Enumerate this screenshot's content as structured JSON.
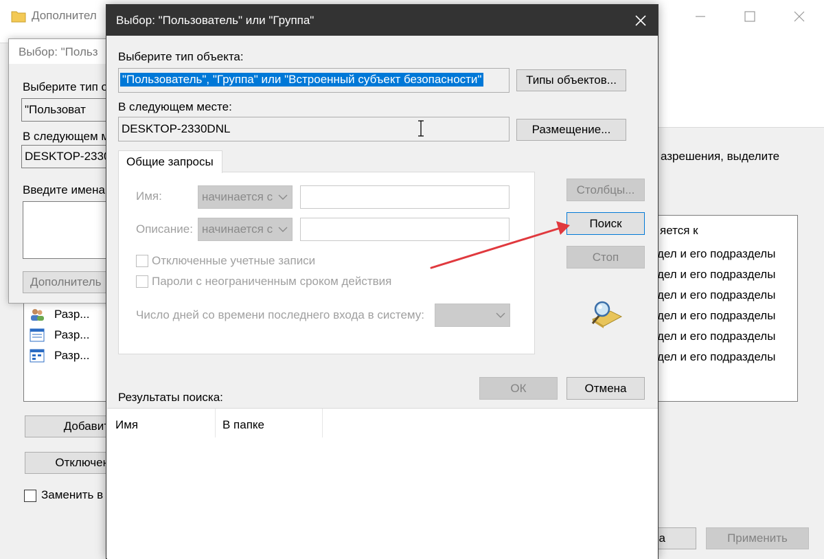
{
  "bg_window": {
    "title": "Дополнител",
    "permissions_text": "азрешения, выделите",
    "column_header": "яется к",
    "inherit_rows": [
      "дел и его подразделы",
      "дел и его подразделы",
      "дел и его подразделы",
      "дел и его подразделы",
      "дел и его подразделы",
      "дел и его подразделы"
    ],
    "perm_items": [
      "Разр...",
      "Разр...",
      "Разр..."
    ],
    "add_button": "Добавит",
    "disable_button": "Отключен",
    "replace_checkbox_label": "Заменить в",
    "ok_button_partial": "на",
    "apply_button": "Применить"
  },
  "mid_dialog": {
    "title": "Выбор: \"Польз",
    "object_type_label": "Выберите тип о",
    "object_type_value": "\"Пользоват",
    "location_label": "В следующем м",
    "location_value": "DESKTOP-2330",
    "enter_names_label": "Введите имена",
    "advanced_button": "Дополнитель"
  },
  "dialog": {
    "title": "Выбор: \"Пользователь\" или \"Группа\"",
    "object_type_label": "Выберите тип объекта:",
    "object_type_value": "\"Пользователь\", \"Группа\" или \"Встроенный субъект безопасности\"",
    "object_types_button": "Типы объектов...",
    "location_label": "В следующем месте:",
    "location_value": "DESKTOP-2330DNL",
    "locations_button": "Размещение...",
    "tab_label": "Общие запросы",
    "name_label": "Имя:",
    "name_combo": "начинается с",
    "description_label": "Описание:",
    "description_combo": "начинается с",
    "disabled_accounts_label": "Отключенные учетные записи",
    "non_expiring_label": "Пароли с неограниченным сроком действия",
    "days_label": "Число дней со времени последнего входа в систему:",
    "columns_button": "Столбцы...",
    "search_button": "Поиск",
    "stop_button": "Стоп",
    "ok_button": "ОК",
    "cancel_button": "Отмена",
    "results_label": "Результаты поиска:",
    "results_columns": [
      "Имя",
      "В папке"
    ]
  },
  "colors": {
    "selection": "#0078d7",
    "titlebar": "#333333",
    "arrow": "#e0393e"
  }
}
